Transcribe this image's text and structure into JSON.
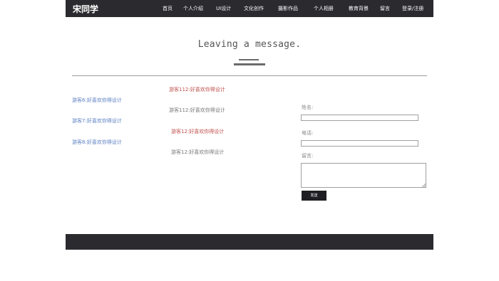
{
  "header": {
    "logo": "宋同学",
    "nav": [
      {
        "label": "首页"
      },
      {
        "label": "个人介绍"
      },
      {
        "label": "UI设计"
      },
      {
        "label": "文化创作"
      },
      {
        "label": "摄影作品"
      },
      {
        "label": "个人相册"
      },
      {
        "label": "教育背景"
      },
      {
        "label": "留言"
      },
      {
        "label": "登录/注册"
      }
    ]
  },
  "section": {
    "title": "Leaving a message."
  },
  "messages": [
    {
      "name": "游客112",
      "sep": ":",
      "text": "好喜欢你得设计",
      "color": "#c0504d"
    },
    {
      "name": "游客6",
      "sep": ":",
      "text": "好喜欢你得设计",
      "color": "#5b7fc2"
    },
    {
      "name": "游客112",
      "sep": ":",
      "text": "好喜欢你得设计",
      "color": "#777777"
    },
    {
      "name": "游客7",
      "sep": ":",
      "text": "好喜欢你得设计",
      "color": "#5b7fc2"
    },
    {
      "name": "游客12",
      "sep": ":",
      "text": "好喜欢你得设计",
      "color": "#c0504d"
    },
    {
      "name": "游客8",
      "sep": ":",
      "text": "好喜欢你得设计",
      "color": "#5b7fc2"
    },
    {
      "name": "游客12",
      "sep": ":",
      "text": "好喜欢你得设计",
      "color": "#777777"
    }
  ],
  "form": {
    "name_label": "姓名:",
    "phone_label": "电话:",
    "message_label": "留言:",
    "name_value": "",
    "phone_value": "",
    "message_value": "",
    "send_label": "发送"
  }
}
